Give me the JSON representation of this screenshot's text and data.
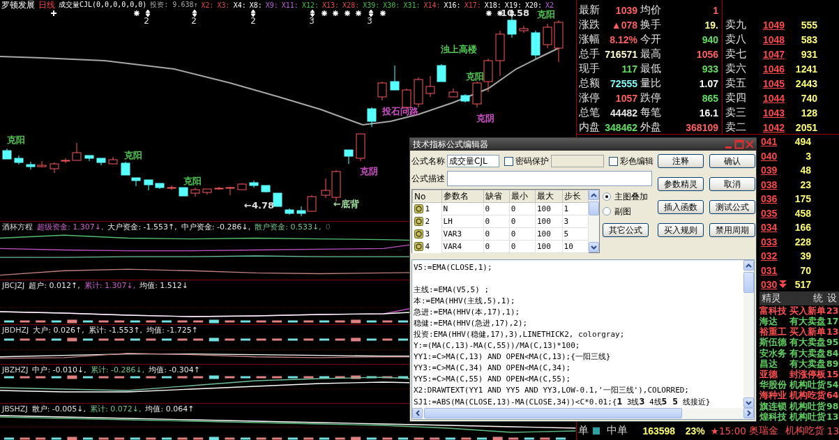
{
  "header": {
    "stock": "罗顿发展",
    "period": "日线",
    "indicator": "成交量CJL(0,0,0,0,0,0)",
    "items": [
      {
        "text": "投资: 9.638↑",
        "color": "#a8a8a8"
      },
      {
        "text": "X2:",
        "color": "#e04848"
      },
      {
        "text": "X3:",
        "color": "#e04848"
      },
      {
        "text": "X4:",
        "color": "#ffffff"
      },
      {
        "text": "X8:",
        "color": "#ffffff"
      },
      {
        "text": "X9:",
        "color": "#c060e0"
      },
      {
        "text": "X11:",
        "color": "#c060e0"
      },
      {
        "text": "X12:",
        "color": "#40c040"
      },
      {
        "text": "X13:",
        "color": "#e04848"
      },
      {
        "text": "X28:",
        "color": "#e04848"
      },
      {
        "text": "X39:",
        "color": "#40c040"
      },
      {
        "text": "X30:",
        "color": "#40c040"
      },
      {
        "text": "X31:",
        "color": "#40c040"
      },
      {
        "text": "X14:",
        "color": "#e04848"
      },
      {
        "text": "X16:",
        "color": "#ffffff"
      },
      {
        "text": "X17:",
        "color": "#e04848"
      },
      {
        "text": "X18:",
        "color": "#ffffff"
      },
      {
        "text": "X19:",
        "color": "#ffffff"
      },
      {
        "text": "X20:",
        "color": "#ffffff"
      },
      {
        "text": "X2",
        "color": "#c060e0"
      }
    ]
  },
  "main_chart": {
    "labels": [
      {
        "text": "克阳",
        "color": "#50c850"
      },
      {
        "text": "克阳",
        "color": "#50c850"
      },
      {
        "text": "克阳",
        "color": "#50c850"
      },
      {
        "text": "克阳",
        "color": "#50c850"
      },
      {
        "text": "克阳",
        "color": "#50c850"
      },
      {
        "text": "克阴",
        "color": "#d050c8"
      },
      {
        "text": "克阴",
        "color": "#d050c8"
      },
      {
        "text": "浊上高楼",
        "color": "#50c850"
      },
      {
        "text": "投石问路",
        "color": "#d050c8"
      },
      {
        "text": "←底背",
        "color": "#a0e0a0"
      },
      {
        "text": "10.58",
        "color": "#e0e0e0"
      },
      {
        "text": "←4.78",
        "color": "#e0e0e0"
      }
    ],
    "counts": [
      "2",
      "2",
      "2",
      "3",
      "3"
    ]
  },
  "panels": [
    {
      "title": "酒杯方程",
      "items": [
        {
          "text": "超级资金: 1.307↓,",
          "color": "#d060d0"
        },
        {
          "text": "大户资金: -1.553↑,",
          "color": "#e8e8e8"
        },
        {
          "text": "中户资金: -0.286↓,",
          "color": "#e8e8e8"
        },
        {
          "text": "散户资金: 0.533↓,",
          "color": "#70c890"
        },
        {
          "text": "0",
          "color": "#505050"
        }
      ]
    },
    {
      "title": "JBCJZJ",
      "items": [
        {
          "text": "超户: 0.012↑,",
          "color": "#e8e8e8"
        },
        {
          "text": "累计: 1.307↓,",
          "color": "#d060d0"
        },
        {
          "text": "均值: 1.512↓",
          "color": "#e8e8e8"
        }
      ]
    },
    {
      "title": "JBDHZJ",
      "items": [
        {
          "text": "大户: 0.026↑,",
          "color": "#e8e8e8"
        },
        {
          "text": "累计: -1.553↑,",
          "color": "#e8e8e8"
        },
        {
          "text": "均值: -1.725↑",
          "color": "#e8e8e8"
        }
      ]
    },
    {
      "title": "JBZHZJ",
      "items": [
        {
          "text": "中户: -0.010↓,",
          "color": "#e8e8e8"
        },
        {
          "text": "累计: -0.286↓,",
          "color": "#70c890"
        },
        {
          "text": "均值: -0.304↑",
          "color": "#e8e8e8"
        }
      ]
    },
    {
      "title": "JBSHZJ",
      "items": [
        {
          "text": "散户: -0.005↓,",
          "color": "#e8e8e8"
        },
        {
          "text": "累计: 0.072↓,",
          "color": "#70c890"
        },
        {
          "text": "均值: 0.064↑",
          "color": "#e8e8e8"
        }
      ]
    }
  ],
  "quote": {
    "rows": [
      {
        "left": {
          "label": "最新",
          "value": "1039",
          "color": "#ff6060"
        },
        "right": {
          "label": "均价",
          "value": "1",
          "color": "#ff6060"
        }
      },
      {
        "left": {
          "label": "涨跌",
          "value": "▲078",
          "color": "#ff6060"
        },
        "right": {
          "label": "换手",
          "value": "19.",
          "color": "#ffff90"
        }
      },
      {
        "left": {
          "label": "涨幅",
          "value": "8.12%",
          "color": "#ff6060"
        },
        "right": {
          "label": "今开",
          "value": "940",
          "color": "#60e060"
        }
      },
      {
        "left": {
          "label": "总手",
          "value": "716571",
          "color": "#ffffd0"
        },
        "right": {
          "label": "最高",
          "value": "1056",
          "color": "#ff6060"
        }
      },
      {
        "left": {
          "label": "现手",
          "value": "117",
          "color": "#60e060"
        },
        "right": {
          "label": "最低",
          "value": "933",
          "color": "#60e060"
        }
      },
      {
        "left": {
          "label": "总额",
          "value": "72555",
          "color": "#80ffff"
        },
        "right": {
          "label": "量比",
          "value": "1.07",
          "color": "#ffffff"
        }
      },
      {
        "left": {
          "label": "涨停",
          "value": "1057",
          "color": "#ff6060"
        },
        "right": {
          "label": "跌停",
          "value": "865",
          "color": "#60e060"
        }
      },
      {
        "left": {
          "label": "总笔",
          "value": "44482",
          "color": "#e8e8e8"
        },
        "right": {
          "label": "每笔",
          "value": "16.1",
          "color": "#ffffff"
        }
      },
      {
        "left": {
          "label": "内盘",
          "value": "348462",
          "color": "#60e060"
        },
        "right": {
          "label": "外盘",
          "value": "368109",
          "color": "#ff6060"
        }
      }
    ]
  },
  "asks": [
    {
      "label": "卖九",
      "price": "1049",
      "volume": "555"
    },
    {
      "label": "卖八",
      "price": "1048",
      "volume": "583"
    },
    {
      "label": "卖七",
      "price": "1047",
      "volume": "931"
    },
    {
      "label": "卖六",
      "price": "1046",
      "volume": "1241"
    },
    {
      "label": "卖五",
      "price": "1045",
      "volume": "2443"
    },
    {
      "label": "卖四",
      "price": "1044",
      "volume": "740"
    },
    {
      "label": "卖三",
      "price": "1043",
      "volume": "128"
    },
    {
      "label": "卖二",
      "price": "1042",
      "volume": "2051"
    }
  ],
  "bids": [
    {
      "price": "041",
      "volume": "494",
      "down_arrow": false
    },
    {
      "price": "040",
      "volume": "3",
      "down_arrow": false
    },
    {
      "price": "039",
      "volume": "48",
      "down_arrow": false
    },
    {
      "price": "038",
      "volume": "23",
      "down_arrow": false
    },
    {
      "price": "036",
      "volume": "175",
      "down_arrow": false
    },
    {
      "price": "035",
      "volume": "458",
      "down_arrow": false
    },
    {
      "price": "034",
      "volume": "166",
      "down_arrow": false
    },
    {
      "price": "033",
      "volume": "228",
      "down_arrow": false
    },
    {
      "price": "032",
      "volume": "39",
      "down_arrow": false
    },
    {
      "price": "031",
      "volume": "70",
      "down_arrow": false
    },
    {
      "price": "030",
      "volume": "517",
      "down_arrow": true
    }
  ],
  "spirit": {
    "title": "精灵",
    "tabs": [
      "统",
      "设"
    ],
    "rows": [
      {
        "name": "富科技",
        "action": "买入新单",
        "count": "23",
        "color": "#ff5050"
      },
      {
        "name": "海达",
        "action": "有大卖盘",
        "count": "17",
        "color": "#60d060"
      },
      {
        "name": "裕重工",
        "action": "买入新单",
        "count": "13",
        "color": "#ff5050"
      },
      {
        "name": "斯伍德",
        "action": "有大卖盘",
        "count": "95",
        "color": "#60d060"
      },
      {
        "name": "安水务",
        "action": "有大卖盘",
        "count": "84",
        "color": "#60d060"
      },
      {
        "name": "昌达",
        "action": "有大卖盘",
        "count": "89",
        "color": "#60d060"
      },
      {
        "name": "亚德",
        "action": "封涨停板",
        "count": "15",
        "color": "#ff5050"
      },
      {
        "name": "华股份",
        "action": "机构吐货",
        "count": "54",
        "color": "#60d060"
      },
      {
        "name": "海种业",
        "action": "机构吃货",
        "count": "64",
        "color": "#ff5050"
      },
      {
        "name": "旗连锁",
        "action": "机构吐货",
        "count": "98",
        "color": "#60d060"
      },
      {
        "name": "煌科技",
        "action": "机构吐货",
        "count": "13",
        "color": "#60d060"
      }
    ]
  },
  "bottom": {
    "label": "单",
    "swatch": {
      "color": "#30a0a0"
    },
    "name": "中单",
    "volume": "163598",
    "percent": "23%"
  },
  "ticker": {
    "time": "★15:00",
    "name": "奥瑞金",
    "action": "机构吃货",
    "count": "13"
  },
  "dialog": {
    "title": "技术指标公式编辑器",
    "name_label": "公式名称",
    "name_value": "成交量CJL",
    "password": {
      "label": "密码保护",
      "checked": false
    },
    "color_edit": {
      "label": "彩色编辑",
      "checked": false
    },
    "desc_label": "公式描述",
    "buttons": [
      "注释",
      "确认",
      "参数精灵",
      "取消",
      "插入函数",
      "测试公式",
      "买入规则",
      "禁用周期"
    ],
    "columns": [
      "No",
      "参数名",
      "缺省",
      "最小",
      "最大",
      "步长"
    ],
    "params": [
      {
        "no": "1",
        "name": "N",
        "default": "0",
        "min": "0",
        "max": "100",
        "step": "1"
      },
      {
        "no": "2",
        "name": "LH",
        "default": "0",
        "min": "0",
        "max": "100",
        "step": "3"
      },
      {
        "no": "3",
        "name": "VAR3",
        "default": "0",
        "min": "0",
        "max": "100",
        "step": "5"
      },
      {
        "no": "4",
        "name": "VAR4",
        "default": "0",
        "min": "0",
        "max": "100",
        "step": "10"
      }
    ],
    "chart_type": [
      {
        "label": "主图叠加",
        "selected": true
      },
      {
        "label": "副图",
        "selected": false
      }
    ],
    "other_button": "其它公式",
    "code_blocks": [
      {
        "lines": [
          "V5:=EMA(CLOSE,1);"
        ]
      },
      {
        "lines": [
          "主线:=EMA(V5,5) ;",
          "本:=EMA(HHV(主线,5),1);",
          "急进:=EMA(HHV(本,17),1);",
          "稳健:=EMA(HHV(急进,17),2);",
          "投资:EMA(HHV(稳健,17),3),LINETHICK2, colorgray;",
          "Y:=(MA(C,13)-MA(C,55))/MA(C,13)*100;",
          "YY1:=C>MA(C,13) AND OPEN<MA(C,13);{一阳三线}",
          "YY3:=C>MA(C,34) AND OPEN<MA(C,34);",
          "YY5:=C>MA(C,55) AND OPEN<MA(C,55);",
          "X2:DRAWTEXT(YY1 AND YY5 AND YY3,LOW-0.1,'一阳三线'),COLORRED;",
          "SJ1:=ABS(MA(CLOSE,13)-MA(CLOSE,34))<C*0.01;{**1** 3线**3** 4线**5 5** 线接近}"
        ]
      }
    ]
  }
}
